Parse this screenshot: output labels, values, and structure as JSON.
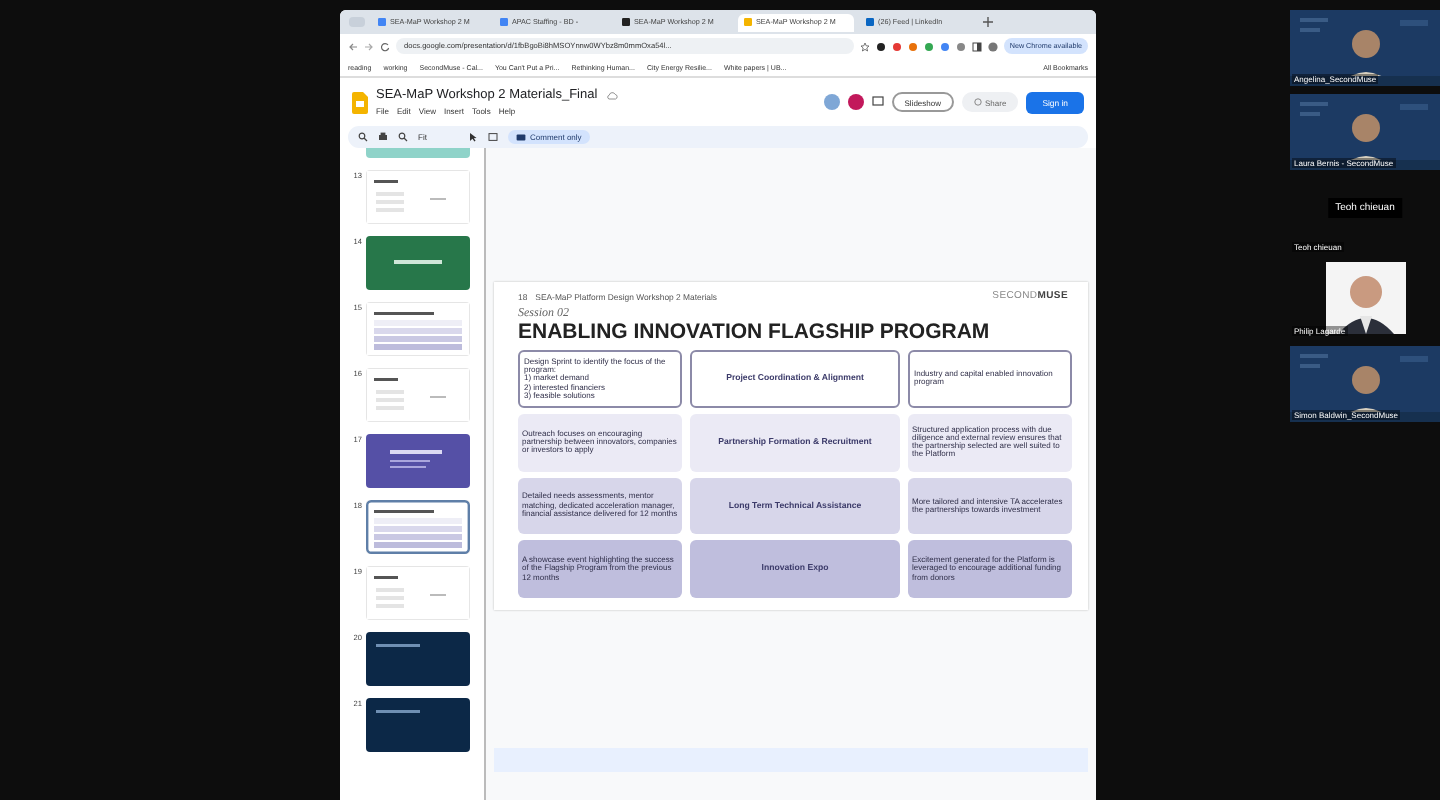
{
  "browser": {
    "tabs": [
      {
        "label": "SEA-MaP Workshop 2 M",
        "selected": false
      },
      {
        "label": "APAC Staffing - BD -",
        "selected": false
      },
      {
        "label": "SEA-MaP Workshop 2 M",
        "selected": false
      },
      {
        "label": "SEA-MaP Workshop 2 M",
        "selected": true
      },
      {
        "label": "(26) Feed | LinkedIn",
        "selected": false
      }
    ],
    "address": "docs.google.com/presentation/d/1fbBgoBi8hMSOYnnw0WYbz8m0mmOxa54l...",
    "update_button": "New Chrome available",
    "bookmarks": [
      "reading",
      "working",
      "SecondMuse - Cal...",
      "You Can't Put a Pri...",
      "Rethinking Human...",
      "City Energy Resilie...",
      "White papers | UB..."
    ],
    "all_bookmarks": "All Bookmarks"
  },
  "docs": {
    "title": "SEA-MaP Workshop 2 Materials_Final",
    "menu": [
      "File",
      "Edit",
      "View",
      "Insert",
      "Tools",
      "Help"
    ],
    "slideshow": "Slideshow",
    "share": "Share",
    "sign_in": "Sign in",
    "zoom": "Fit",
    "mode": "Comment only"
  },
  "filmstrip": [
    {
      "kind": "teal",
      "selected": false
    },
    {
      "number": "13",
      "kind": "white",
      "selected": false
    },
    {
      "number": "14",
      "kind": "green",
      "selected": false
    },
    {
      "number": "15",
      "kind": "table",
      "selected": false
    },
    {
      "number": "16",
      "kind": "white",
      "selected": false
    },
    {
      "number": "17",
      "kind": "purple",
      "selected": false
    },
    {
      "number": "18",
      "kind": "table",
      "selected": true
    },
    {
      "number": "19",
      "kind": "white",
      "selected": false
    },
    {
      "number": "20",
      "kind": "navy",
      "selected": false
    },
    {
      "number": "21",
      "kind": "navy",
      "selected": false
    }
  ],
  "slide": {
    "number": "18",
    "header": "SEA-MaP Platform Design Workshop 2 Materials",
    "logo_light": "SECOND",
    "logo_bold": "MUSE",
    "session": "Session 02",
    "title": "ENABLING INNOVATION FLAGSHIP PROGRAM",
    "rows": [
      {
        "left": "Design Sprint to identify the focus of the program:\n1) market demand\n2) interested financiers\n3) feasible solutions",
        "center": "Project Coordination & Alignment",
        "right": "Industry and capital enabled innovation program"
      },
      {
        "left": "Outreach focuses on encouraging partnership between innovators, companies or investors to apply",
        "center": "Partnership Formation & Recruitment",
        "right": "Structured application process with due diligence and external review ensures that the partnership selected are well suited to the Platform"
      },
      {
        "left": "Detailed needs assessments, mentor matching, dedicated acceleration manager, financial assistance delivered for 12 months",
        "center": "Long Term Technical Assistance",
        "right": "More tailored and intensive TA accelerates the partnerships towards investment"
      },
      {
        "left": "A showcase event highlighting the success of the Flagship Program from the previous 12 months",
        "center": "Innovation Expo",
        "right": "Excitement generated for the Platform is leveraged to encourage additional funding from donors"
      }
    ]
  },
  "participants": [
    {
      "kind": "video",
      "name": "Angelina_SecondMuse"
    },
    {
      "kind": "video",
      "name": "Laura Bernis - SecondMuse"
    },
    {
      "kind": "camera-off",
      "name": "Teoh chieuan",
      "label": "Teoh chieuan"
    },
    {
      "name": "Philip Lagarde"
    },
    {
      "kind": "video",
      "name": "Simon Baldwin_SecondMuse"
    }
  ]
}
